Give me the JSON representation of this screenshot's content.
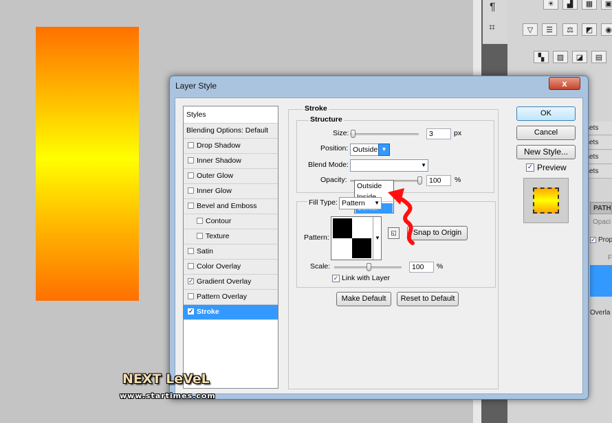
{
  "dialog": {
    "title": "Layer Style",
    "close_glyph": "x"
  },
  "styles_list": {
    "header": "Styles",
    "blending": "Blending Options: Default",
    "items": [
      {
        "label": "Drop Shadow",
        "checked": false
      },
      {
        "label": "Inner Shadow",
        "checked": false
      },
      {
        "label": "Outer Glow",
        "checked": false
      },
      {
        "label": "Inner Glow",
        "checked": false
      },
      {
        "label": "Bevel and Emboss",
        "checked": false
      },
      {
        "label": "Contour",
        "checked": false
      },
      {
        "label": "Texture",
        "checked": false
      },
      {
        "label": "Satin",
        "checked": false
      },
      {
        "label": "Color Overlay",
        "checked": false
      },
      {
        "label": "Gradient Overlay",
        "checked": true
      },
      {
        "label": "Pattern Overlay",
        "checked": false
      },
      {
        "label": "Stroke",
        "checked": true,
        "selected": true
      }
    ],
    "check_glyph": "✓"
  },
  "stroke": {
    "title": "Stroke",
    "structure_title": "Structure",
    "size_label": "Size:",
    "size_value": "3",
    "size_unit": "px",
    "position_label": "Position:",
    "position_value": "Outside",
    "position_options": [
      "Outside",
      "Inside",
      "Center"
    ],
    "blend_label": "Blend Mode:",
    "opacity_label": "Opacity:",
    "opacity_value": "100",
    "opacity_unit": "%",
    "fill_type_label": "Fill Type:",
    "fill_type_value": "Pattern",
    "pattern_label": "Pattern:",
    "snap_button": "Snap to Origin",
    "scale_label": "Scale:",
    "scale_value": "100",
    "scale_unit": "%",
    "link_label": "Link with Layer",
    "link_checked": true,
    "make_default": "Make Default",
    "reset_default": "Reset to Default"
  },
  "right_buttons": {
    "ok": "OK",
    "cancel": "Cancel",
    "new_style": "New Style...",
    "preview_label": "Preview",
    "preview_checked": true
  },
  "background_panel": {
    "tool_glyphs": [
      "¶",
      "⌗"
    ],
    "row_labels": [
      "sets",
      "sets",
      "sets",
      "sets"
    ],
    "paths_tab": "PATH",
    "opacity_fragment": "Opaci",
    "prop_fragment": "Prop",
    "f_fragment": "F",
    "overlay_fragment": "Overla"
  },
  "watermark": {
    "line1": "NEXT LeVeL",
    "line2": "www.startimes.com"
  },
  "colors": {
    "selection_blue": "#3399ff",
    "gradient_orange": "#ff7000",
    "gradient_yellow": "#ffff00",
    "annotation_red": "#ff1010"
  }
}
